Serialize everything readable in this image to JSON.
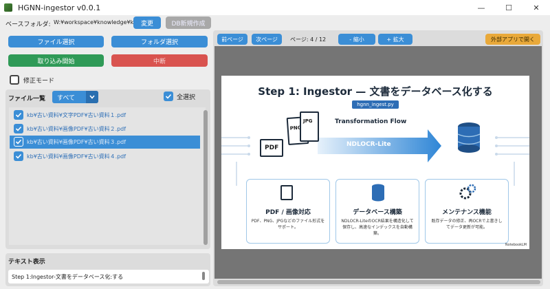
{
  "window": {
    "title": "HGNN-ingestor v0.0.1",
    "minimize": "—",
    "maximize": "☐",
    "close": "✕"
  },
  "toolbar": {
    "base_folder_label": "ベースフォルダ:",
    "base_folder_path": "W:¥workspace¥knowledge¥kb",
    "change_button": "変更",
    "db_create_button": "DB新規作成"
  },
  "left": {
    "file_select": "ファイル選択",
    "folder_select": "フォルダ選択",
    "start_import": "取り込み開始",
    "abort": "中断",
    "edit_mode": "修正モード",
    "file_list_label": "ファイル一覧",
    "filter_value": "すべて",
    "select_all": "全選択",
    "files": [
      {
        "name": "kb¥古い資料¥文字PDF¥古い資料１.pdf",
        "checked": true,
        "selected": false
      },
      {
        "name": "kb¥古い資料¥画像PDF¥古い資料２.pdf",
        "checked": true,
        "selected": false
      },
      {
        "name": "kb¥古い資料¥画像PDF¥古い資料３.pdf",
        "checked": true,
        "selected": true
      },
      {
        "name": "kb¥古い資料¥画像PDF¥古い資料４.pdf",
        "checked": true,
        "selected": false
      }
    ],
    "text_display_label": "テキスト表示",
    "text_display_value": "Step 1:Ingestor-文書をデータベース化:する"
  },
  "viewer": {
    "prev_page": "前ページ",
    "next_page": "次ページ",
    "page_info": "ページ: 4 / 12",
    "zoom_out": "- 縮小",
    "zoom_in": "+ 拡大",
    "open_external": "外部アプリで開く"
  },
  "slide": {
    "title": "Step 1: Ingestor — 文書をデータベース化する",
    "tag": "hgnn_ingest.py",
    "flow_label": "Transformation Flow",
    "ocr_label": "NDLOCR-Lite",
    "doc_labels": [
      "PDF",
      "PNG",
      "JPG"
    ],
    "cards": [
      {
        "title": "PDF / 画像対応",
        "text": "PDF、PNG、JPGなどのファイル形式をサポート。"
      },
      {
        "title": "データベース構築",
        "text": "NDLOCR-LiteのOCR結果を構造化して保存し、高速なインデックスを自動構築。"
      },
      {
        "title": "メンテナンス機能",
        "text": "既存データの修正、再OCRで上書きしてデータ更新が可能。"
      }
    ],
    "watermark": "NotebookLM"
  },
  "colors": {
    "accent": "#3b8ed6",
    "start": "#2f9a57",
    "abort": "#d9534f",
    "external": "#e9a93a"
  }
}
